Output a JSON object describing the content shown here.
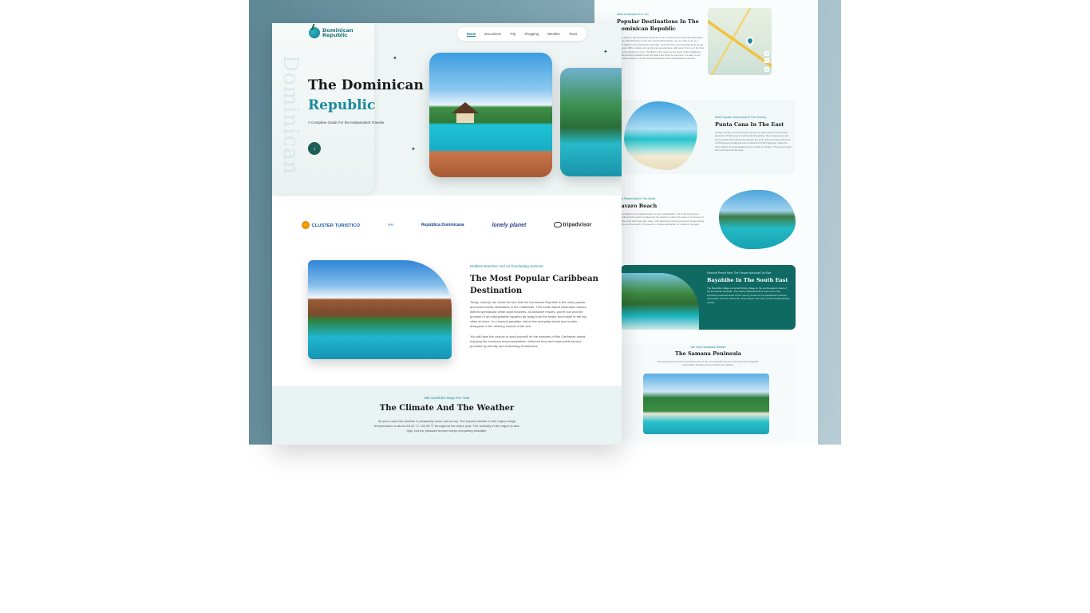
{
  "brand": {
    "line1": "Dominican",
    "line2": "Republic",
    "watermark": "Dominican"
  },
  "nav": {
    "items": [
      "Home",
      "Excursions",
      "Trip",
      "Shopping",
      "Weather",
      "Tours"
    ],
    "active": "Home"
  },
  "hero": {
    "title_line1": "The Dominican",
    "title_line2": "Republic",
    "subtitle": "A Complete Guide For the Independent Traveler",
    "cta_icon": "arrow-down-icon"
  },
  "partners": [
    "CLUSTER TURISTICO",
    "",
    "República Dominicana",
    "lonely planet",
    "tripadvisor"
  ],
  "section_beaches": {
    "kicker": "Endless Beaches And An Everlasting Summer",
    "title": "The Most Popular Caribbean Destination",
    "para1": "Today, nobody can doubt the fact that the Dominican Republic is the most popular and loved tourist destination in the Caribbean. This exotic island fascinates visitors with its spectacular white sand beaches, all-inclusive resorts, you're sun and the promise of an unforgettable vacation far away from the hustle and bustle of the big cities at home. In a tropical paradise, where the everyday stress and routine disappear in the relaxing sounds of life sea.",
    "para2": "You will have the chance to spoil yourself on the beaches of this Caribbean island, enjoying the luxurious accommodations, delicious food and impeccable service provided by friendly and welcoming Dominicans."
  },
  "climate": {
    "kicker": "365 Sunshine Days Per Year",
    "title": "The Climate And The Weather",
    "body": "All year round the weather is pleasantly warm and sunny. The tropical climate in this region brings temperatures to about 28-32 °C / 82-90 °F throughout the entire year. The humidity in the region is also high, but the pleasant breeze keeps everything bearable."
  },
  "side": {
    "intro_kicker": "What Destination For You",
    "intro_title": "Popular Destinations In The Dominican Republic",
    "intro_text": "In this section, the Dominican Republic tours a mixture of exceptional landscapes, pristine cultural history of the city and the Blue Nature. As you start to go to a beach district in the Dominican Republic, you'll find the most beautiful spots along the coast. With a variety of resorts and opportunities, with sand, it's one of the best places for tourists to come. The Best in the region is the coast of the Caribbean, and the amazing beaches and the island are ideal for everyone. It's easy to get beyond the edges of the Dominican Republic. Best destinations to explore.",
    "punta": {
      "kicker": "Most Popular Tourist Area In The Country",
      "title": "Punta Cana In The East",
      "text": "A huge number of tourist resorts are set up each year in Punta Cana along the 40 kilometers of white sand beaches. The temperatures are very popular and relaxing throughout the year, with an annual minimum of 23 degrees centigrade and a maximum of 28.5 degrees, while the rainy season is concentrated in the months of October. The resorts have been built around the area."
    },
    "bavaro": {
      "kicker": "Hotel Resort Best In The World",
      "title": "Bavaro Beach",
      "text": "Bavaro Beach is a coastal location on the southeastern end of the Dominican Republic and the south, bordered by the western coast in the area. It is famous for its white sand and clear blue water, with luxurious hotels and resorts located along the shore of the beach. The beach is a great destination for visitors of all ages."
    },
    "bayahibe": {
      "kicker": "Seaside Resort Near The Parque Nacional Del Este",
      "title": "Bayahibe In The South East",
      "text": "The Bayahibe village is a small fishing village on the south-eastern coast of the Dominican Republic. The nearby National Park is one of the most important protected areas of the country, known for its spectacular beaches, coral reefs, and rich marine life. Tours depart from here to the beautiful islands nearby."
    },
    "samana": {
      "kicker": "Not Only Humpback Whales",
      "title": "The Samana Peninsula",
      "text": "The Samana peninsula is considered one of the most beautiful areas in the Dominican Republic, with pristine beaches and a relaxed atmosphere."
    }
  },
  "icons": {
    "hero_cta": "arrow-down-icon",
    "sparkle": "sparkle-icon",
    "map_pin": "map-pin-icon"
  },
  "colors": {
    "accent": "#1a8a9c",
    "dark_teal": "#0f6a63",
    "hero_bg": "#eef5f4"
  }
}
